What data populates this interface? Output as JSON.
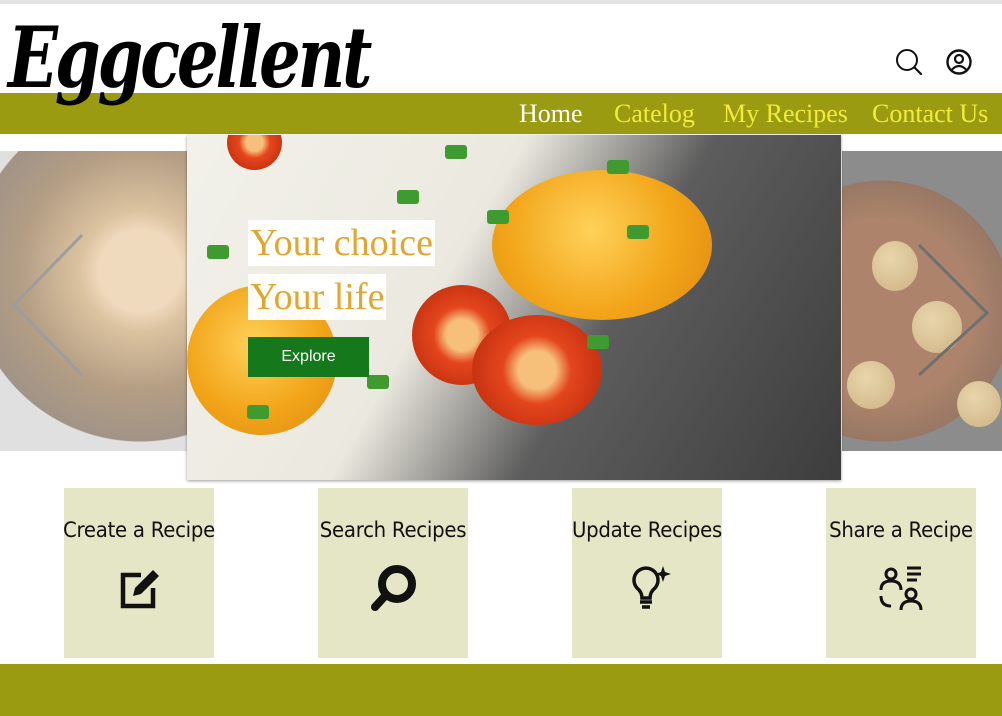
{
  "brand": {
    "logo": "Eggcellent"
  },
  "nav": {
    "home": "Home",
    "catalog": "Catelog",
    "my_recipes": "My Recipes",
    "contact": "Contact Us"
  },
  "header_icons": [
    "search-icon",
    "user-account-icon"
  ],
  "hero": {
    "line1": "Your choice",
    "line2": "Your life",
    "button": "Explore"
  },
  "cards": [
    {
      "title": "Create a Recipe",
      "icon": "edit-icon"
    },
    {
      "title": "Search Recipes",
      "icon": "magnifier-icon"
    },
    {
      "title": "Update Recipes",
      "icon": "lightbulb-sparkle-icon"
    },
    {
      "title": "Share a Recipe",
      "icon": "share-users-icon"
    }
  ],
  "colors": {
    "nav_bar": "#9b9b12",
    "nav_active": "#ffffff",
    "nav_link": "#f1eb3d",
    "button": "#15791b",
    "card": "#e5e6c6"
  }
}
